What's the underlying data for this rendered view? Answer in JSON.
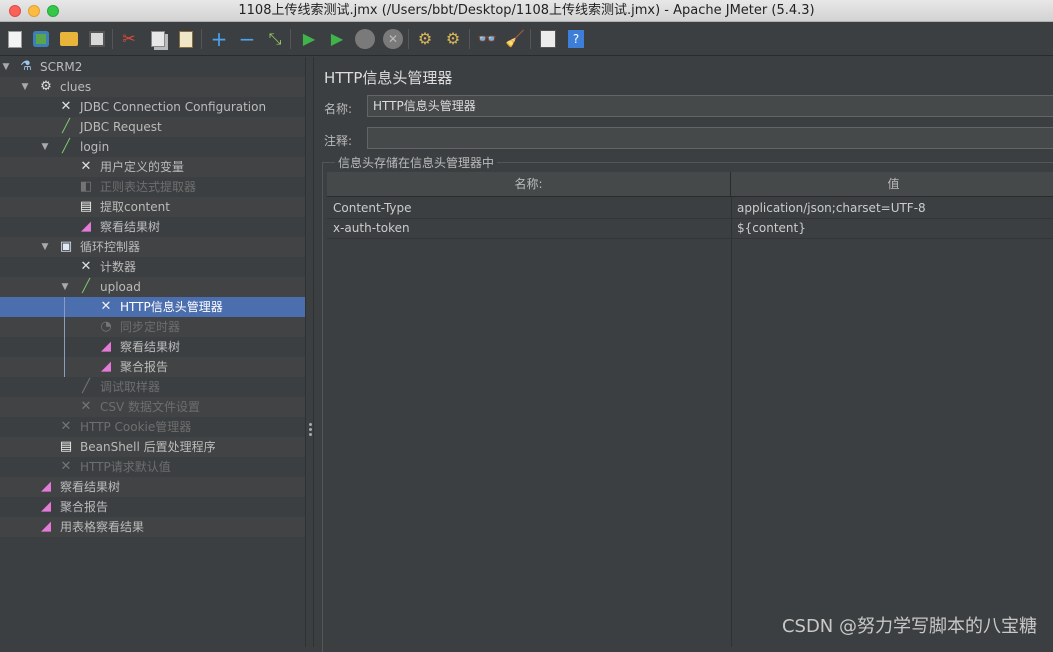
{
  "window": {
    "title": "1108上传线索测试.jmx (/Users/bbt/Desktop/1108上传线索测试.jmx) - Apache JMeter (5.4.3)"
  },
  "toolbar": {
    "buttons": [
      "new-icon",
      "templates-icon",
      "open-icon",
      "save-icon",
      "cut-icon",
      "copy-icon",
      "paste-icon",
      "expand-icon",
      "collapse-icon",
      "toggle-icon",
      "start-icon",
      "start-no-pause-icon",
      "stop-icon",
      "shutdown-icon",
      "clear-icon",
      "clear-all-icon",
      "search-icon",
      "reset-search-icon",
      "function-helper-icon",
      "help-icon"
    ]
  },
  "tree": {
    "items": [
      {
        "label": "SCRM2",
        "icon": "flask-icon"
      },
      {
        "label": "clues",
        "icon": "gear-icon"
      },
      {
        "label": "JDBC Connection Configuration",
        "icon": "wrench-icon"
      },
      {
        "label": "JDBC Request",
        "icon": "pipette-icon"
      },
      {
        "label": "login",
        "icon": "pipette-icon"
      },
      {
        "label": "用户定义的变量",
        "icon": "wrench-icon"
      },
      {
        "label": "正则表达式提取器",
        "icon": "extractor-icon"
      },
      {
        "label": "提取content",
        "icon": "document-icon"
      },
      {
        "label": "察看结果树",
        "icon": "chart-icon"
      },
      {
        "label": "循环控制器",
        "icon": "controller-icon"
      },
      {
        "label": "计数器",
        "icon": "wrench-icon"
      },
      {
        "label": "upload",
        "icon": "pipette-icon"
      },
      {
        "label": "HTTP信息头管理器",
        "icon": "wrench-icon"
      },
      {
        "label": "同步定时器",
        "icon": "timer-icon"
      },
      {
        "label": "察看结果树",
        "icon": "chart-icon"
      },
      {
        "label": "聚合报告",
        "icon": "chart-icon"
      },
      {
        "label": "调试取样器",
        "icon": "pipette-icon"
      },
      {
        "label": "CSV 数据文件设置",
        "icon": "wrench-icon"
      },
      {
        "label": "HTTP Cookie管理器",
        "icon": "wrench-icon"
      },
      {
        "label": "BeanShell 后置处理程序",
        "icon": "document-icon"
      },
      {
        "label": "HTTP请求默认值",
        "icon": "wrench-icon"
      },
      {
        "label": "察看结果树",
        "icon": "chart-icon"
      },
      {
        "label": "聚合报告",
        "icon": "chart-icon"
      },
      {
        "label": "用表格察看结果",
        "icon": "chart-icon"
      }
    ]
  },
  "panel": {
    "title": "HTTP信息头管理器",
    "name_label": "名称:",
    "name_value": "HTTP信息头管理器",
    "comment_label": "注释:",
    "comment_value": "",
    "group_title": "信息头存储在信息头管理器中",
    "table": {
      "headers": [
        "名称:",
        "值"
      ],
      "rows": [
        [
          "Content-Type",
          "application/json;charset=UTF-8"
        ],
        [
          "x-auth-token",
          "${content}"
        ]
      ]
    }
  },
  "watermark": "CSDN @努力学写脚本的八宝糖",
  "colors": {
    "background": "#3c3f41",
    "selection": "#4b6eaf",
    "text": "#bbbbbb"
  }
}
